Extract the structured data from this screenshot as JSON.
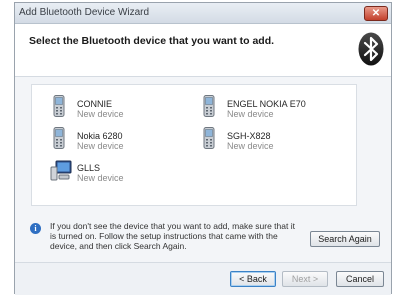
{
  "window": {
    "title": "Add Bluetooth Device Wizard",
    "close_label": "✕"
  },
  "header": {
    "text": "Select the Bluetooth device that you want to add.",
    "logo_icon": "bluetooth-icon"
  },
  "devices": [
    {
      "name": "CONNIE",
      "status": "New device",
      "icon": "mobile-phone-icon"
    },
    {
      "name": "ENGEL NOKIA E70",
      "status": "New device",
      "icon": "mobile-phone-icon"
    },
    {
      "name": "Nokia 6280",
      "status": "New device",
      "icon": "mobile-phone-icon"
    },
    {
      "name": "SGH-X828",
      "status": "New device",
      "icon": "mobile-phone-icon"
    },
    {
      "name": "GLLS",
      "status": "New device",
      "icon": "computer-icon"
    }
  ],
  "info": {
    "text": "If you don't see the device that you want to add, make sure that it is turned on. Follow the setup instructions that came with the device, and then click Search Again."
  },
  "buttons": {
    "search_again": "Search Again",
    "back": "< Back",
    "next": "Next >",
    "cancel": "Cancel"
  }
}
